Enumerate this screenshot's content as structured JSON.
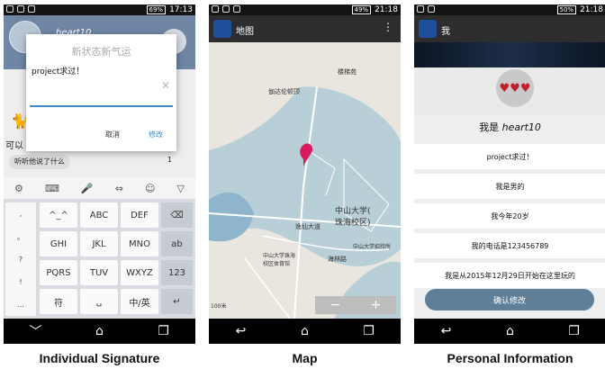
{
  "screens": {
    "signature": {
      "status": {
        "battery": "69%",
        "time": "17:13"
      },
      "profile_name": "heart10",
      "under_text": "可以",
      "action_label": "听听他说了什么",
      "like_count": "1",
      "dialog": {
        "title": "新状态新气运",
        "input_value": "project求过！",
        "cancel_label": "取消",
        "confirm_label": "修改"
      },
      "keyboard": {
        "side_keys": [
          ",",
          "。",
          "?",
          "!",
          "..."
        ],
        "rows": [
          [
            "^_^",
            "ABC",
            "DEF",
            "⌫"
          ],
          [
            "GHI",
            "JKL",
            "MNO",
            "ab"
          ],
          [
            "PQRS",
            "TUV",
            "WXYZ",
            "123"
          ],
          [
            "符",
            "␣",
            "中/英",
            "↵"
          ]
        ]
      }
    },
    "map": {
      "status": {
        "battery": "49%",
        "time": "21:18"
      },
      "title": "地图",
      "labels": {
        "poi1": "楼梯苑",
        "poi2": "伽达伦顿顶",
        "campus": "中山大学(\n珠海校区)",
        "road1": "逸仙大道",
        "road2": "海林路",
        "hotel": "中山大学招待所",
        "gym": "中山大学珠海\n校区体育馆"
      },
      "scale": "100米",
      "zoom_out": "−",
      "zoom_in": "+"
    },
    "personal": {
      "status": {
        "battery": "50%",
        "time": "21:18"
      },
      "title": "我",
      "iam_prefix": "我是",
      "iam_name": "heart10",
      "rows": [
        "project求过！",
        "我是男的",
        "我今年20岁",
        "我的电话是123456789",
        "我是从2015年12月29日开始在这里玩的"
      ],
      "confirm_label": "确认修改"
    }
  },
  "captions": [
    "Individual Signature",
    "Map",
    "Personal Information"
  ]
}
